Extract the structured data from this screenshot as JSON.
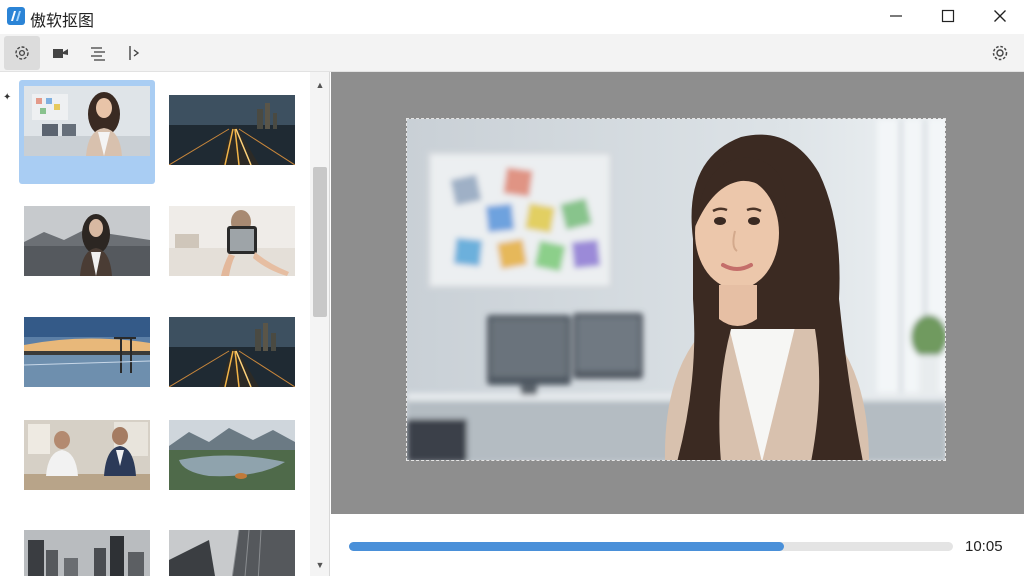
{
  "window": {
    "title": "傲软抠图",
    "controls": [
      "minimize-icon",
      "maximize-icon",
      "close-icon"
    ]
  },
  "toolbar": {
    "tools": [
      {
        "icon": "settings-spark-icon",
        "active": true
      },
      {
        "icon": "video-camera-icon",
        "active": false
      },
      {
        "icon": "align-list-icon",
        "active": false
      },
      {
        "icon": "split-arrow-icon",
        "active": false
      }
    ],
    "settings_icon": "gear-icon"
  },
  "sidebar": {
    "pin_glyph": "✦",
    "thumbnails": [
      {
        "scene": "woman-office",
        "selected": true
      },
      {
        "scene": "city-night-road",
        "selected": false
      },
      {
        "scene": "woman-mono",
        "selected": false
      },
      {
        "scene": "hands-phone",
        "selected": false
      },
      {
        "scene": "lake-sunset",
        "selected": false
      },
      {
        "scene": "city-night-road",
        "selected": false
      },
      {
        "scene": "business-meeting",
        "selected": false
      },
      {
        "scene": "mountain-river",
        "selected": false
      },
      {
        "scene": "city-skyline-mono",
        "selected": false
      },
      {
        "scene": "building-perspective",
        "selected": false
      }
    ],
    "scroll_up_glyph": "▲",
    "scroll_down_glyph": "▼"
  },
  "playback": {
    "progress": 0.72,
    "time": "10:05",
    "accent": "#4a90d9"
  },
  "colors": {
    "selected_bg": "#a9cdf3",
    "preview_bg": "#8e8e8e"
  }
}
